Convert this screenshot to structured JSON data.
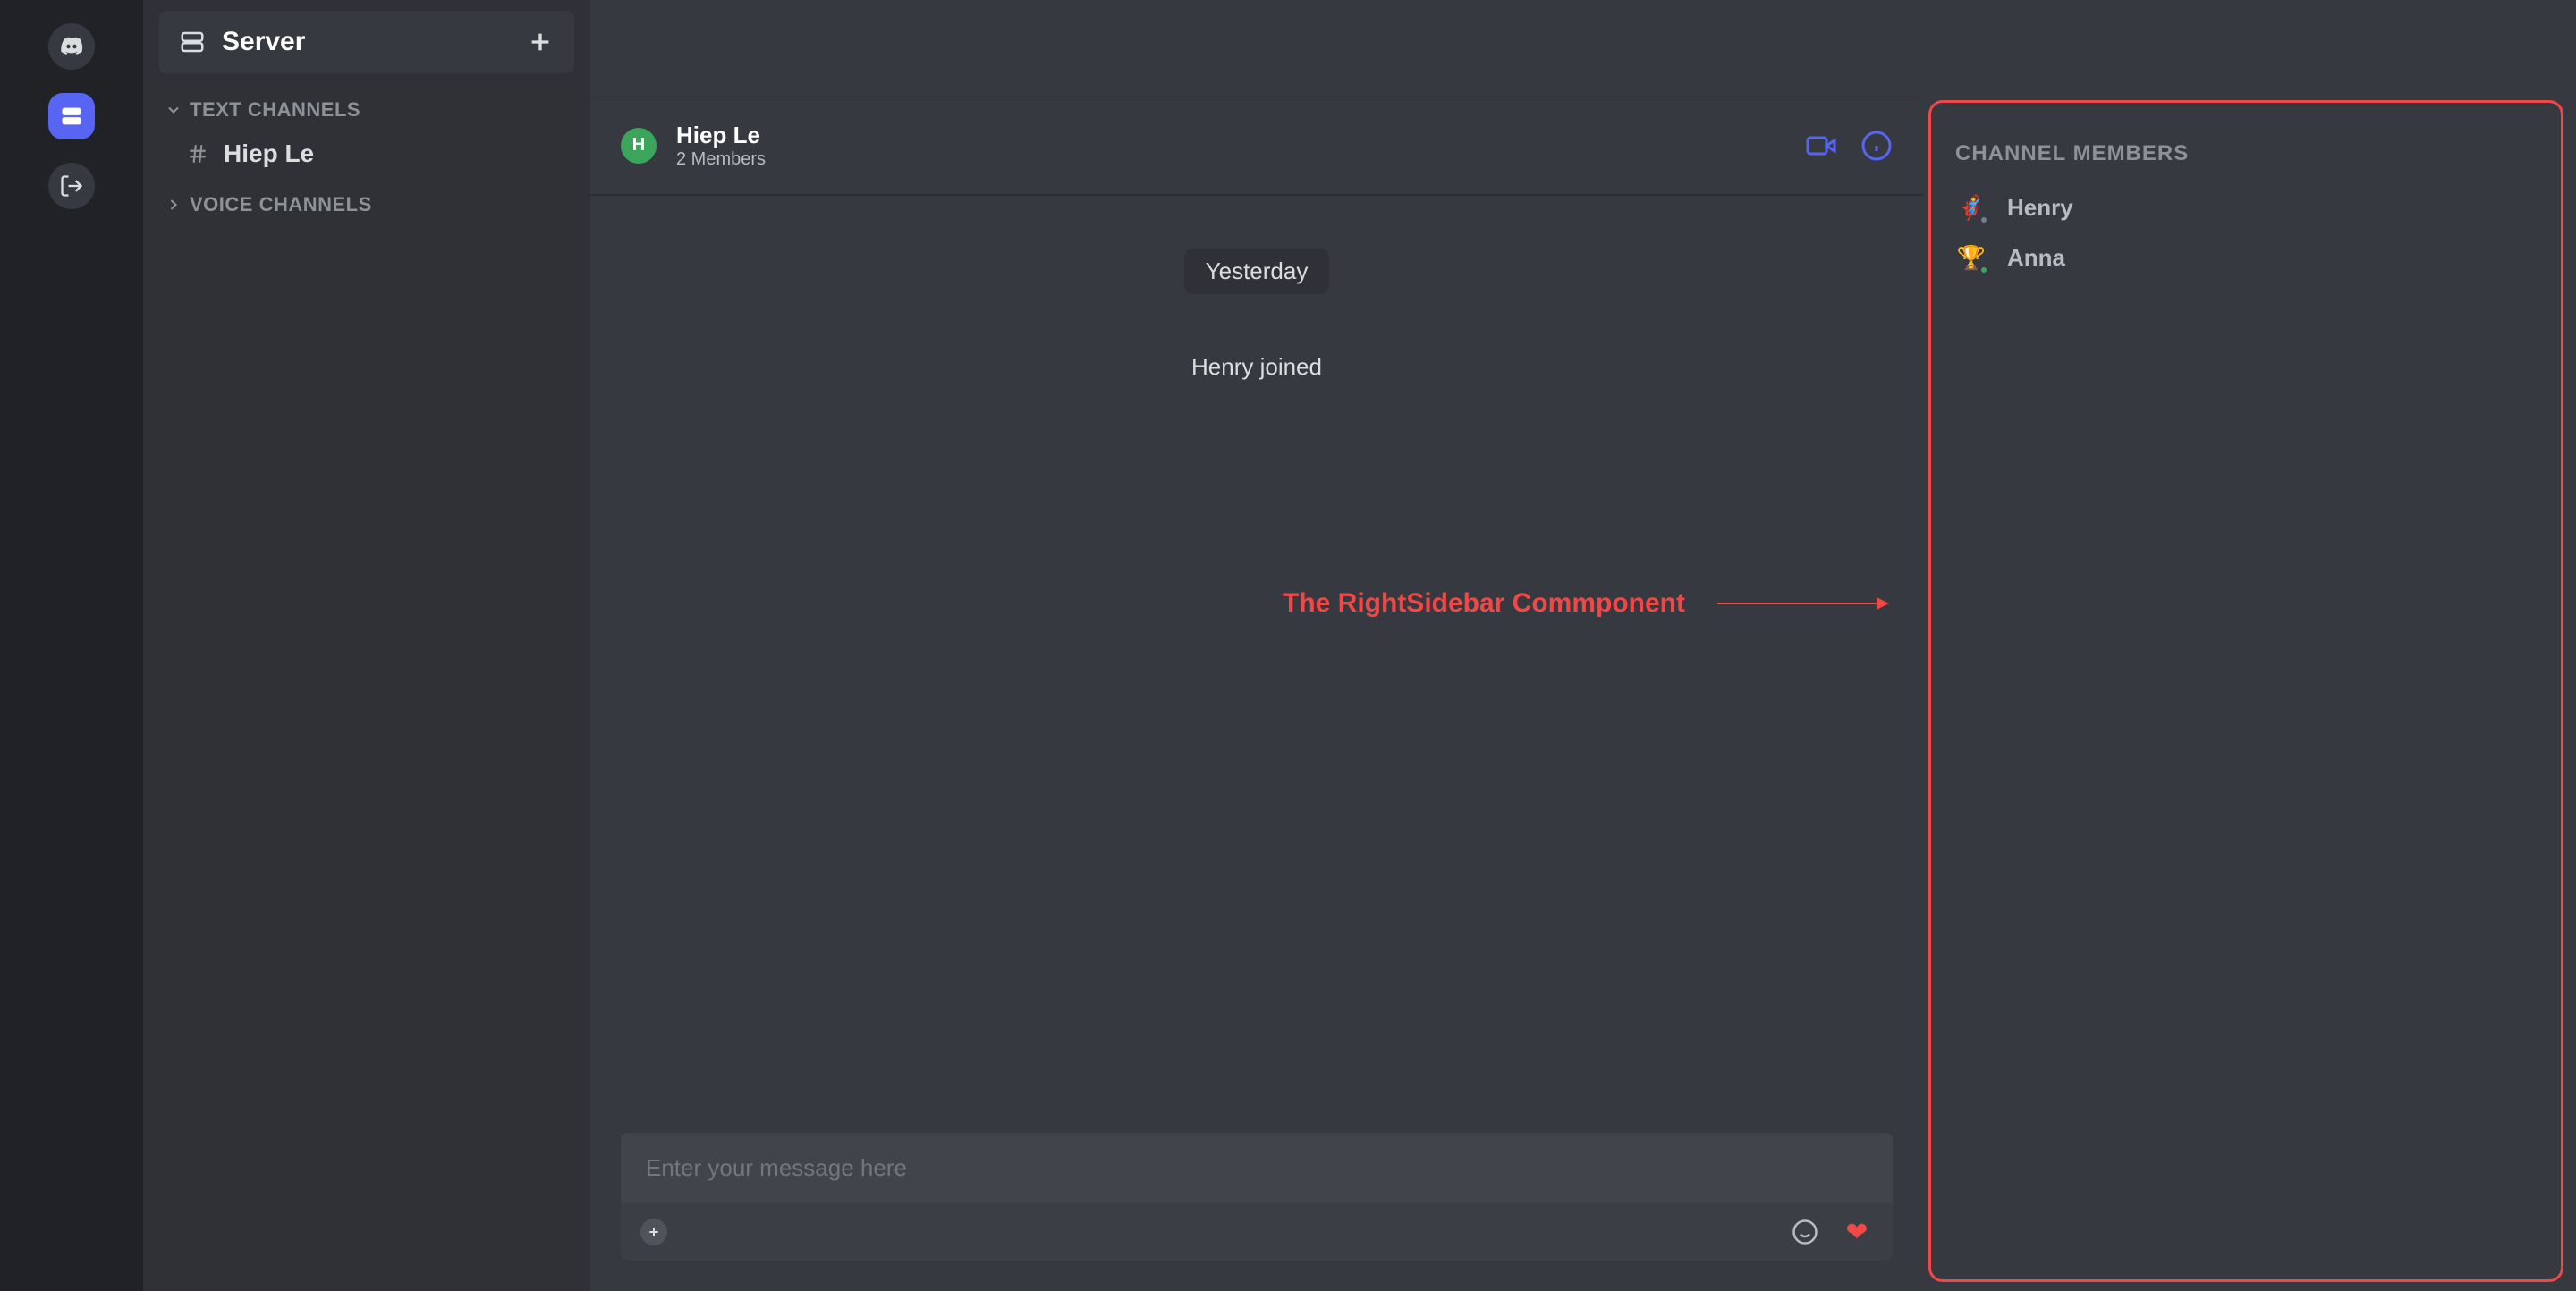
{
  "server_bar": {
    "items": [
      {
        "name": "discord-home",
        "active": false
      },
      {
        "name": "server-icon",
        "active": true
      },
      {
        "name": "logout-icon",
        "active": false
      }
    ]
  },
  "channel_sidebar": {
    "server_label": "Server",
    "text_section": "Text Channels",
    "voice_section": "Voice Channels",
    "channels": [
      {
        "label": "Hiep Le"
      }
    ]
  },
  "chat": {
    "title": "Hiep Le",
    "subtitle": "2 Members",
    "avatar_letter": "H",
    "date_divider": "Yesterday",
    "system_message": "Henry joined",
    "input_placeholder": "Enter your message here"
  },
  "annotation": {
    "label": "The RightSidebar Commponent"
  },
  "right_sidebar": {
    "header": "Channel Members",
    "members": [
      {
        "name": "Henry",
        "emoji": "🦸",
        "status": "offline"
      },
      {
        "name": "Anna",
        "emoji": "🏆",
        "status": "online"
      }
    ]
  },
  "colors": {
    "accent": "#5865f2",
    "danger": "#f04747",
    "green": "#3ba55c"
  }
}
